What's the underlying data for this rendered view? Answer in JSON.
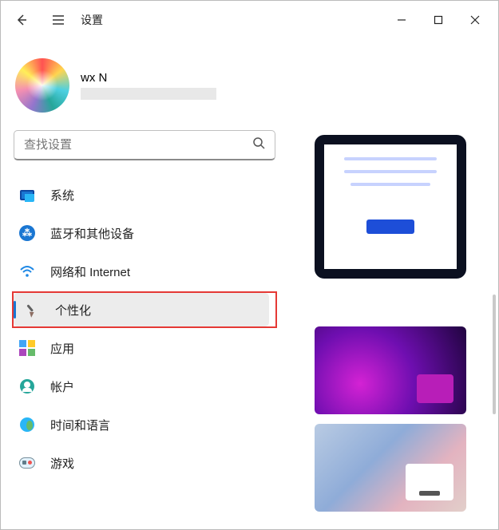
{
  "titlebar": {
    "title": "设置"
  },
  "profile": {
    "name": "wx N"
  },
  "search": {
    "placeholder": "查找设置"
  },
  "nav": {
    "items": [
      {
        "label": "系统",
        "icon": "monitor-icon",
        "selected": false
      },
      {
        "label": "蓝牙和其他设备",
        "icon": "bluetooth-icon",
        "selected": false
      },
      {
        "label": "网络和 Internet",
        "icon": "wifi-icon",
        "selected": false
      },
      {
        "label": "个性化",
        "icon": "brush-icon",
        "selected": true,
        "highlighted": true
      },
      {
        "label": "应用",
        "icon": "apps-icon",
        "selected": false
      },
      {
        "label": "帐户",
        "icon": "user-icon",
        "selected": false
      },
      {
        "label": "时间和语言",
        "icon": "globe-icon",
        "selected": false
      },
      {
        "label": "游戏",
        "icon": "game-icon",
        "selected": false
      }
    ]
  }
}
